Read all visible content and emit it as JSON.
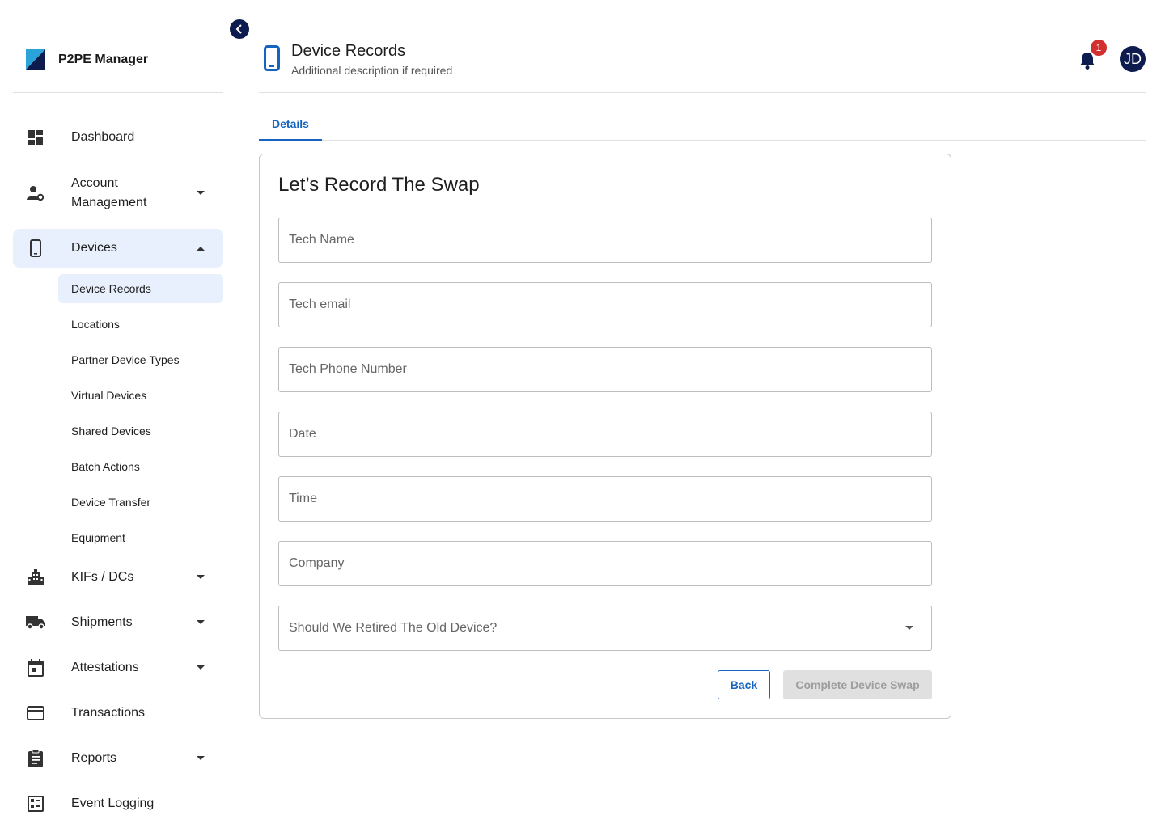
{
  "app": {
    "name": "P2PE Manager"
  },
  "colors": {
    "accent": "#1565c0",
    "navy": "#0d1b4f",
    "active_bg": "#e8f0fd",
    "badge": "#d32f2f"
  },
  "sidebar": {
    "items": [
      {
        "label": "Dashboard",
        "icon": "dashboard-icon"
      },
      {
        "label": "Account Management",
        "icon": "account-settings-icon"
      },
      {
        "label": "Devices",
        "icon": "smartphone-icon"
      },
      {
        "label": "KIFs / DCs",
        "icon": "building-icon"
      },
      {
        "label": "Shipments",
        "icon": "truck-icon"
      },
      {
        "label": "Attestations",
        "icon": "calendar-icon"
      },
      {
        "label": "Transactions",
        "icon": "credit-card-icon"
      },
      {
        "label": "Reports",
        "icon": "clipboard-icon"
      },
      {
        "label": "Event Logging",
        "icon": "list-icon"
      }
    ],
    "device_subitems": [
      "Device Records",
      "Locations",
      "Partner Device Types",
      "Virtual Devices",
      "Shared Devices",
      "Batch Actions",
      "Device Transfer",
      "Equipment"
    ]
  },
  "header": {
    "title": "Device Records",
    "subtitle": "Additional description if required",
    "notification_count": "1",
    "avatar_initials": "JD"
  },
  "tabs": [
    {
      "label": "Details"
    }
  ],
  "form": {
    "title": "Let’s Record The Swap",
    "fields": {
      "tech_name": "Tech Name",
      "tech_email": "Tech email",
      "tech_phone": "Tech Phone Number",
      "date": "Date",
      "time": "Time",
      "company": "Company",
      "retire_old": "Should We Retired The Old Device?"
    },
    "back_label": "Back",
    "complete_label": "Complete Device Swap"
  }
}
